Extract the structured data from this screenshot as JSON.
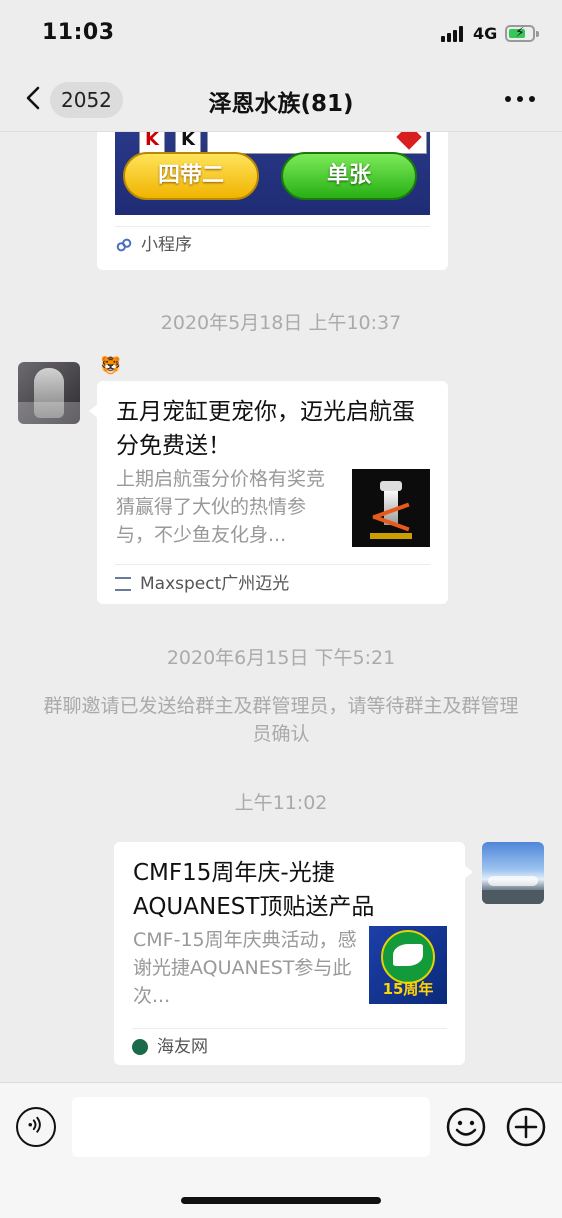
{
  "status_bar": {
    "time": "11:03",
    "network": "4G"
  },
  "nav": {
    "back_count": "2052",
    "title": "泽恩水族(81)"
  },
  "messages": {
    "mini_program": {
      "btn_left": "四带二",
      "btn_right": "单张",
      "footer": "小程序"
    },
    "timestamp1": "2020年5月18日 上午10:37",
    "article1": {
      "sender_badge": "🐯",
      "title": "五月宠缸更宠你，迈光启航蛋分免费送！",
      "desc": "上期启航蛋分价格有奖竞猜赢得了大伙的热情参与，不少鱼友化身...",
      "source": "Maxspect广州迈光"
    },
    "timestamp2": "2020年6月15日 下午5:21",
    "system_notice": "群聊邀请已发送给群主及群管理员，请等待群主及群管理员确认",
    "timestamp3": "上午11:02",
    "article2": {
      "title": "CMF15周年庆-光捷AQUANEST顶贴送产品",
      "desc": "CMF-15周年庆典活动，感谢光捷AQUANEST参与此次...",
      "thumb_text": "15周年",
      "source": "海友网"
    }
  },
  "colors": {
    "bg": "#ededed",
    "card": "#ffffff",
    "muted": "#aaaaaa",
    "accent_yellow": "#f5c400",
    "accent_green": "#2fc12f"
  },
  "icons": [
    "back-chevron-icon",
    "more-icon",
    "voice-icon",
    "emoji-icon",
    "plus-icon",
    "mini-program-icon"
  ]
}
